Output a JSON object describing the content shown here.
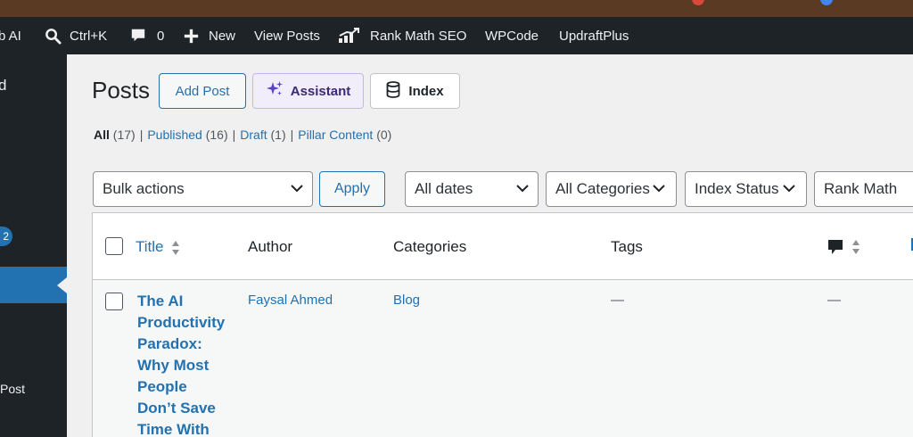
{
  "adminbar": {
    "site_label": "b AI",
    "search_shortcut": "Ctrl+K",
    "comments_count": "0",
    "new_label": "New",
    "view_posts_label": "View Posts",
    "rank_math_label": "Rank Math SEO",
    "wpcode_label": "WPCode",
    "updraftplus_label": "UpdraftPlus"
  },
  "sidebar": {
    "partial_item_letter": "d",
    "badge_count": "2",
    "partial_post_label": "Post"
  },
  "header": {
    "title": "Posts",
    "add_post_label": "Add Post",
    "assistant_label": "Assistant",
    "index_label": "Index"
  },
  "filters_status": [
    {
      "label": "All",
      "count": "(17)",
      "current": true
    },
    {
      "label": "Published",
      "count": "(16)"
    },
    {
      "label": "Draft",
      "count": "(1)"
    },
    {
      "label": "Pillar Content",
      "count": "(0)"
    }
  ],
  "toolbar": {
    "bulk_actions": "Bulk actions",
    "apply_label": "Apply",
    "dates": "All dates",
    "categories": "All Categories",
    "index_status": "Index Status",
    "rank_math": "Rank Math"
  },
  "table": {
    "columns": {
      "title": "Title",
      "author": "Author",
      "categories": "Categories",
      "tags": "Tags"
    },
    "rows": [
      {
        "title_lines": [
          "The AI",
          "Productivity",
          "Paradox:",
          "Why Most",
          "People",
          "Don’t Save",
          "Time With"
        ],
        "author": "Faysal Ahmed",
        "categories": "Blog",
        "tags": "—",
        "comments": "—"
      }
    ]
  },
  "colors": {
    "admin_dark": "#1d2327",
    "link_blue": "#2271b1",
    "assistant_purple": "#3b2a74"
  }
}
